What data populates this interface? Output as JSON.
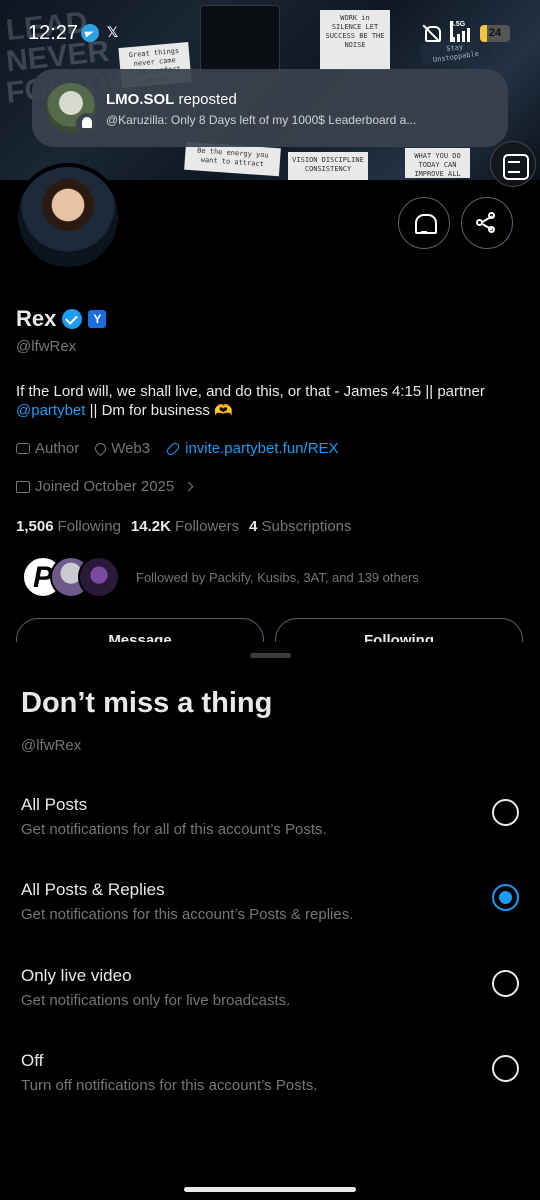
{
  "status_bar": {
    "time": "12:27",
    "network": "4.5G",
    "battery_level": "24",
    "battery_fraction": 0.24,
    "icons": [
      "telegram-icon",
      "x-icon",
      "mute-icon",
      "signal-icon",
      "battery-icon"
    ]
  },
  "notification": {
    "title_bold": "LMO.SOL",
    "title_rest": " reposted",
    "text": "@Karuzilla: Only 8 Days left of my 1000$ Leaderboard a..."
  },
  "banner": {
    "big_words": [
      "LEAD",
      "NEVER",
      "FOLLOW"
    ],
    "notes": [
      "Great things never came from comfort zones",
      "WORK in SILENCE LET SUCCESS BE THE NOISE",
      "Be the energy you want to attract",
      "VISION DISCIPLINE CONSISTENCY",
      "WHAT YOU DO TODAY CAN IMPROVE ALL YOUR TOMORROWS",
      "Stay Unstoppable"
    ]
  },
  "profile": {
    "name": "Rex",
    "affiliate_badge": "Y",
    "handle": "@lfwRex",
    "bio_before": "If the Lord will, we shall live, and do this, or that - James 4:15 || partner ",
    "bio_link": "@partybet",
    "bio_after": " || Dm for business 🫶",
    "category": "Author",
    "location": "Web3",
    "website": "invite.partybet.fun/REX",
    "joined": "Joined October 2025",
    "following_count": "1,506",
    "following_label": "Following",
    "followers_count": "14.2K",
    "followers_label": "Followers",
    "subscriptions_count": "4",
    "subscriptions_label": "Subscriptions",
    "followed_by": "Followed by Packify, Kusibs, 3AT, and 139 others",
    "message_button": "Message",
    "following_button": "Following"
  },
  "sheet": {
    "title": "Don’t miss a thing",
    "handle": "@lfwRex",
    "options": [
      {
        "label": "All Posts",
        "desc": "Get notifications for all of this account’s Posts.",
        "selected": false
      },
      {
        "label": "All Posts & Replies",
        "desc": "Get notifications for this account’s Posts & replies.",
        "selected": true
      },
      {
        "label": "Only live video",
        "desc": "Get notifications only for live broadcasts.",
        "selected": false
      },
      {
        "label": "Off",
        "desc": "Turn off notifications for this account’s Posts.",
        "selected": false
      }
    ]
  },
  "colors": {
    "accent": "#1d9bf0",
    "text_primary": "#e7e9ea",
    "text_secondary": "#71767b",
    "background": "#000000"
  }
}
